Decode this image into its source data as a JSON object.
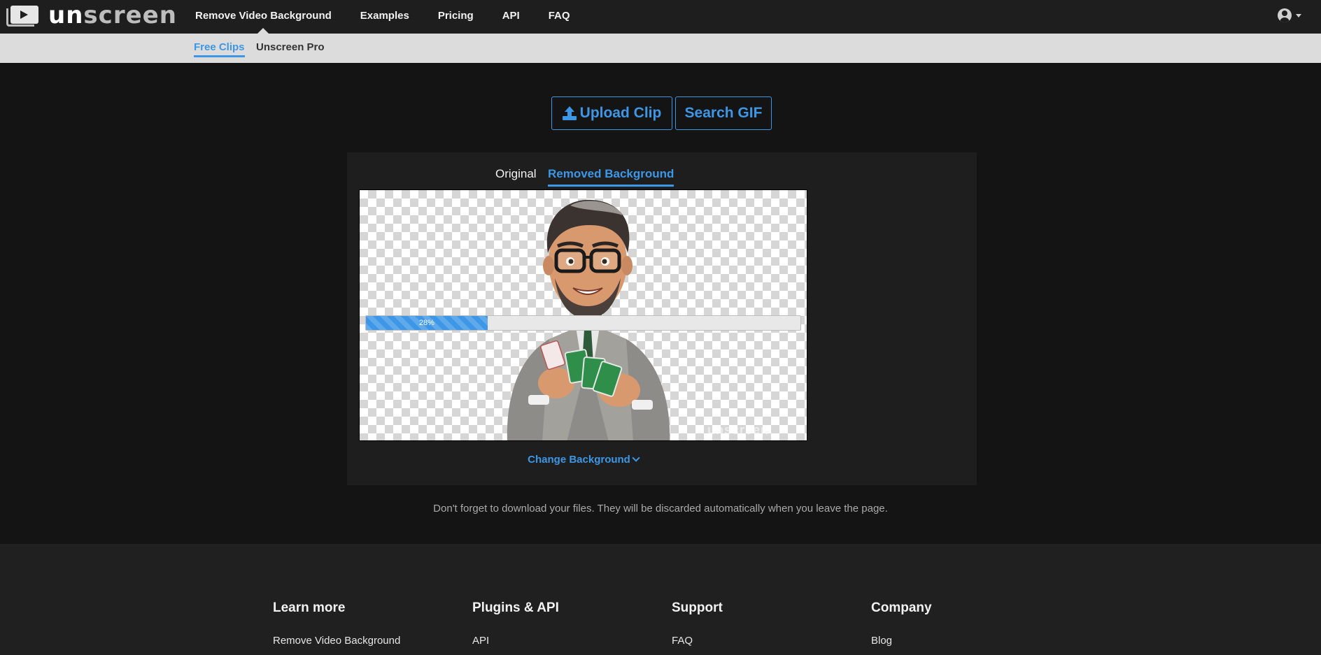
{
  "header": {
    "logo_text_primary": "un",
    "logo_text_secondary": "screen",
    "nav": [
      {
        "label": "Remove Video Background",
        "active": true
      },
      {
        "label": "Examples"
      },
      {
        "label": "Pricing"
      },
      {
        "label": "API"
      },
      {
        "label": "FAQ"
      }
    ],
    "account_icon": "user-circle-icon"
  },
  "subnav": {
    "items": [
      {
        "label": "Free Clips",
        "active": true
      },
      {
        "label": "Unscreen Pro"
      }
    ]
  },
  "actions": {
    "upload_label": "Upload Clip",
    "search_label": "Search GIF"
  },
  "result": {
    "tabs": [
      {
        "label": "Original"
      },
      {
        "label": "Removed Background",
        "active": true
      }
    ],
    "progress": {
      "percent": 28,
      "label": "28%"
    },
    "change_background_label": "Change Background"
  },
  "notice": "Don't forget to download your files. They will be discarded automatically when you leave the page.",
  "footer": {
    "columns": [
      {
        "heading": "Learn more",
        "links": [
          "Remove Video Background"
        ]
      },
      {
        "heading": "Plugins & API",
        "links": [
          "API"
        ]
      },
      {
        "heading": "Support",
        "links": [
          "FAQ"
        ]
      },
      {
        "heading": "Company",
        "links": [
          "Blog"
        ]
      }
    ]
  },
  "colors": {
    "accent": "#3d97e6",
    "nav_bg": "#1e1e1e",
    "subnav_bg": "#dcdcdc",
    "page_bg": "#141414"
  }
}
